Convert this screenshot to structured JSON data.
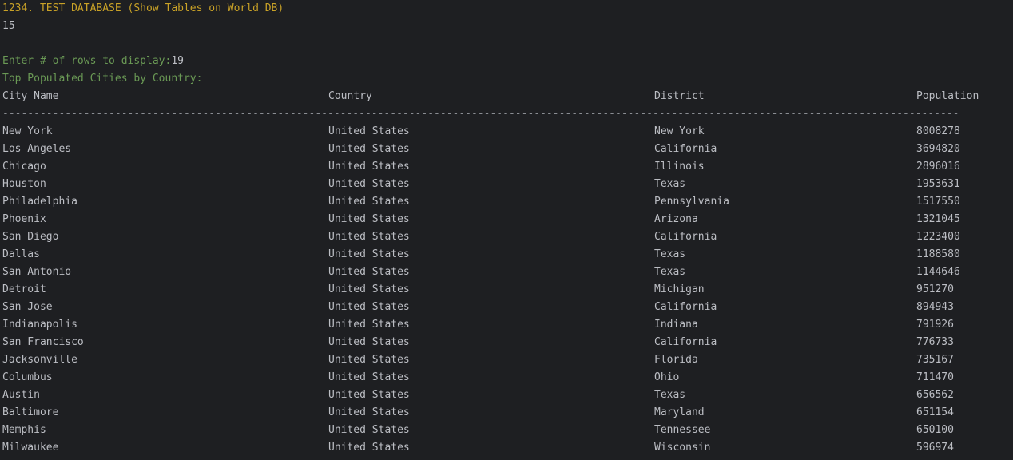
{
  "console": {
    "menu_line": "1234. TEST DATABASE (Show Tables on World DB)",
    "choice": "15",
    "prompt_label": "Enter # of rows to display:",
    "prompt_value": "19",
    "table_title": "Top Populated Cities by Country:",
    "headers": [
      "City Name",
      "Country",
      "District",
      "Population"
    ],
    "separator": "---------------------------------------------------------------------------------------------------------------------------------------------------------",
    "rows": [
      [
        "New York",
        "United States",
        "New York",
        "8008278"
      ],
      [
        "Los Angeles",
        "United States",
        "California",
        "3694820"
      ],
      [
        "Chicago",
        "United States",
        "Illinois",
        "2896016"
      ],
      [
        "Houston",
        "United States",
        "Texas",
        "1953631"
      ],
      [
        "Philadelphia",
        "United States",
        "Pennsylvania",
        "1517550"
      ],
      [
        "Phoenix",
        "United States",
        "Arizona",
        "1321045"
      ],
      [
        "San Diego",
        "United States",
        "California",
        "1223400"
      ],
      [
        "Dallas",
        "United States",
        "Texas",
        "1188580"
      ],
      [
        "San Antonio",
        "United States",
        "Texas",
        "1144646"
      ],
      [
        "Detroit",
        "United States",
        "Michigan",
        "951270"
      ],
      [
        "San Jose",
        "United States",
        "California",
        "894943"
      ],
      [
        "Indianapolis",
        "United States",
        "Indiana",
        "791926"
      ],
      [
        "San Francisco",
        "United States",
        "California",
        "776733"
      ],
      [
        "Jacksonville",
        "United States",
        "Florida",
        "735167"
      ],
      [
        "Columbus",
        "United States",
        "Ohio",
        "711470"
      ],
      [
        "Austin",
        "United States",
        "Texas",
        "656562"
      ],
      [
        "Baltimore",
        "United States",
        "Maryland",
        "651154"
      ],
      [
        "Memphis",
        "United States",
        "Tennessee",
        "650100"
      ],
      [
        "Milwaukee",
        "United States",
        "Wisconsin",
        "596974"
      ]
    ]
  }
}
